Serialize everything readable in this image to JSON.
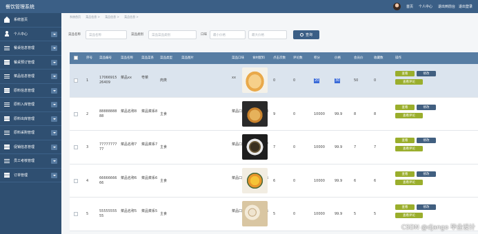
{
  "app": {
    "title": "餐饮管理系统"
  },
  "header": {
    "links": [
      "首页",
      "个人中心",
      "退出到前台",
      "退出登录"
    ]
  },
  "sidebar": {
    "items": [
      {
        "label": "系统首页",
        "icon": "home-icon",
        "chevron": false
      },
      {
        "label": "个人中心",
        "icon": "user-icon",
        "chevron": true
      },
      {
        "label": "餐桌信息管理",
        "icon": "menu-icon",
        "chevron": true
      },
      {
        "label": "餐桌预订管理",
        "icon": "menu-icon",
        "chevron": true
      },
      {
        "label": "菜品信息管理",
        "icon": "menu-icon",
        "chevron": true
      },
      {
        "label": "原料信息管理",
        "icon": "menu-icon",
        "chevron": true
      },
      {
        "label": "原料入库管理",
        "icon": "menu-icon",
        "chevron": true
      },
      {
        "label": "原料出库管理",
        "icon": "menu-icon",
        "chevron": true
      },
      {
        "label": "原料采购管理",
        "icon": "menu-icon",
        "chevron": true
      },
      {
        "label": "促销信息管理",
        "icon": "menu-icon",
        "chevron": true
      },
      {
        "label": "员工考核管理",
        "icon": "menu-icon",
        "chevron": true
      },
      {
        "label": "订单管理",
        "icon": "menu-icon",
        "chevron": true
      }
    ]
  },
  "breadcrumb": [
    "系统首页",
    "菜品信息 >",
    "菜品信息 >",
    "菜品信息 >"
  ],
  "filter": {
    "name_label": "菜品名称",
    "name_placeholder": "菜品名称",
    "type_label": "菜品类别",
    "type_placeholder": "菜品菜品类别",
    "taste_label": "口味",
    "taste_placeholder": "最小价格",
    "max_placeholder": "最大价格",
    "search_label": "查询"
  },
  "table": {
    "headers": [
      "序号",
      "菜品编号",
      "菜品名称",
      "菜品菜系",
      "菜品类型",
      "菜品图片",
      "菜品口味",
      "食材配料",
      "点击次数",
      "评论数",
      "积分",
      "价格",
      "会员价",
      "收藏数",
      "操作"
    ],
    "rows": [
      {
        "idx": "1",
        "code": "1706691526409",
        "name": "菜品xx",
        "cuisine": "粤菜",
        "type": "肉类",
        "taste": "xx",
        "ingredients": "xx",
        "clicks": "0",
        "comments": "0",
        "points": "20",
        "price": "30",
        "member_price": "50",
        "favorites": "0",
        "highlight": true,
        "food": "fried"
      },
      {
        "idx": "2",
        "code": "8888888888",
        "name": "菜品名称8",
        "cuisine": "菜品菜系8",
        "type": "主食",
        "taste": "菜品口味8",
        "ingredients": "食材配料8",
        "clicks": "9",
        "comments": "0",
        "points": "10000",
        "price": "99.9",
        "member_price": "8",
        "favorites": "8",
        "highlight": false,
        "food": "pancake"
      },
      {
        "idx": "3",
        "code": "7777777777",
        "name": "菜品名称7",
        "cuisine": "菜品菜系7",
        "type": "主食",
        "taste": "菜品口味7",
        "ingredients": "食材配料7",
        "clicks": "7",
        "comments": "0",
        "points": "10000",
        "price": "99.9",
        "member_price": "7",
        "favorites": "7",
        "highlight": false,
        "food": "soup"
      },
      {
        "idx": "4",
        "code": "6666666666",
        "name": "菜品名称6",
        "cuisine": "菜品菜系6",
        "type": "主食",
        "taste": "菜品口味6",
        "ingredients": "食材配料6",
        "clicks": "6",
        "comments": "0",
        "points": "10000",
        "price": "99.9",
        "member_price": "6",
        "favorites": "6",
        "highlight": false,
        "food": "egg"
      },
      {
        "idx": "5",
        "code": "5555555555",
        "name": "菜品名称5",
        "cuisine": "菜品菜系5",
        "type": "主食",
        "taste": "菜品口味5",
        "ingredients": "食材配料5",
        "clicks": "5",
        "comments": "0",
        "points": "10000",
        "price": "99.9",
        "member_price": "5",
        "favorites": "5",
        "highlight": false,
        "food": "dumpling"
      }
    ],
    "actions": {
      "view": "查看",
      "edit": "修改",
      "review": "查看评论"
    }
  },
  "watermark": "CSDN @django 毕业设计"
}
